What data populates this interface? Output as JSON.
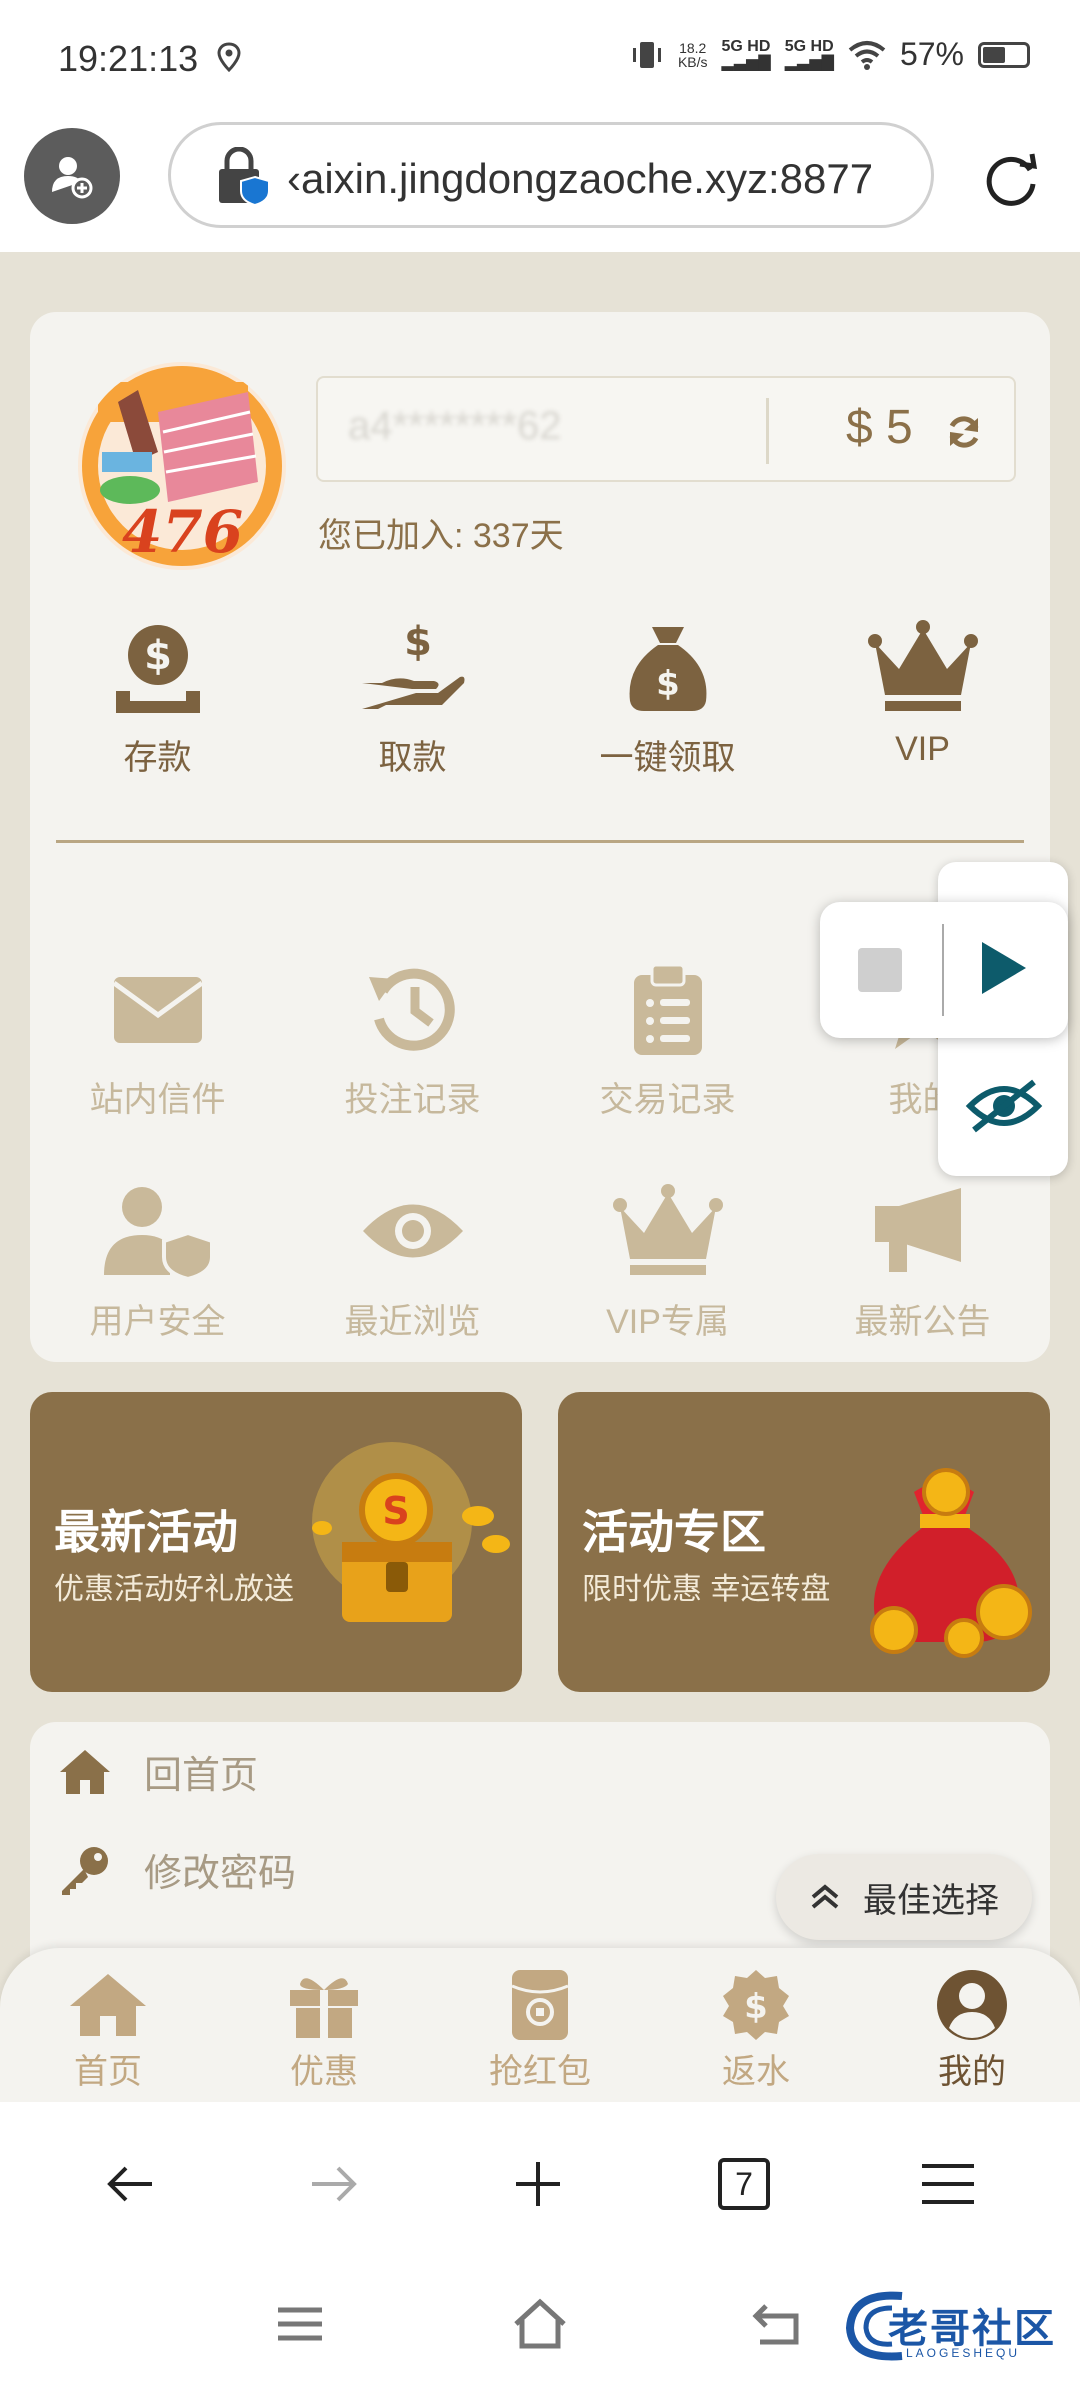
{
  "status_bar": {
    "time": "19:21:13",
    "net_speed_value": "18.2",
    "net_speed_unit": "KB/s",
    "signal1": "5G HD",
    "signal2": "5G HD",
    "battery": "57%"
  },
  "browser": {
    "url": "‹aixin.jingdongzaoche.xyz:8877",
    "tab_count": "7"
  },
  "profile": {
    "avatar_number": "476",
    "account_name": "a4********62",
    "balance": "$ 5",
    "joined": "您已加入: 337天"
  },
  "actions": [
    {
      "label": "存款",
      "icon": "deposit-icon"
    },
    {
      "label": "取款",
      "icon": "withdraw-icon"
    },
    {
      "label": "一键领取",
      "icon": "money-bag-icon"
    },
    {
      "label": "VIP",
      "icon": "crown-icon"
    }
  ],
  "features_row1": [
    {
      "label": "站内信件",
      "icon": "mail-icon"
    },
    {
      "label": "投注记录",
      "icon": "history-icon"
    },
    {
      "label": "交易记录",
      "icon": "clipboard-icon"
    },
    {
      "label": "我的",
      "icon": "star-icon"
    }
  ],
  "features_row2": [
    {
      "label": "用户安全",
      "icon": "user-shield-icon"
    },
    {
      "label": "最近浏览",
      "icon": "eye-icon"
    },
    {
      "label": "VIP专属",
      "icon": "crown-icon"
    },
    {
      "label": "最新公告",
      "icon": "megaphone-icon"
    }
  ],
  "promos": [
    {
      "title": "最新活动",
      "subtitle": "优惠活动好礼放送"
    },
    {
      "title": "活动专区",
      "subtitle": "限时优惠 幸运转盘"
    }
  ],
  "menu": [
    {
      "label": "回首页",
      "icon": "home-icon"
    },
    {
      "label": "修改密码",
      "icon": "key-icon"
    }
  ],
  "best_choice": "最佳选择",
  "tabs": [
    {
      "label": "首页",
      "icon": "home-icon"
    },
    {
      "label": "优惠",
      "icon": "gift-icon"
    },
    {
      "label": "抢红包",
      "icon": "red-packet-icon"
    },
    {
      "label": "返水",
      "icon": "rebate-icon"
    },
    {
      "label": "我的",
      "icon": "user-circle-icon",
      "active": true
    }
  ],
  "watermark": {
    "title": "老哥社区",
    "subtitle": "LAOGESHEQU"
  },
  "colors": {
    "accent": "#8a7049",
    "background": "#e6e2d6",
    "card": "#f4f3ef"
  }
}
